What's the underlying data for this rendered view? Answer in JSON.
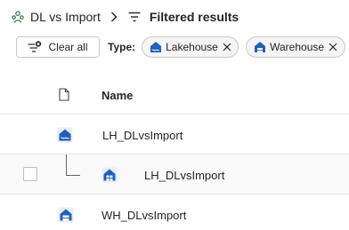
{
  "breadcrumb": {
    "workspace": "DL vs Import",
    "current": "Filtered results",
    "workspace_icon": "workspace-people-icon",
    "separator_icon": "chevron-right-icon",
    "filter_icon": "filter-lines-icon"
  },
  "filters": {
    "clear_label": "Clear all",
    "type_label": "Type:",
    "chips": [
      {
        "label": "Lakehouse",
        "icon": "lakehouse-icon"
      },
      {
        "label": "Warehouse",
        "icon": "warehouse-icon"
      }
    ]
  },
  "table": {
    "columns": {
      "name": "Name"
    },
    "rows": [
      {
        "name": "LH_DLvsImport",
        "type": "Lakehouse",
        "level": 0
      },
      {
        "name": "LH_DLvsImport",
        "type": "SQL analytics endpoint",
        "level": 1
      },
      {
        "name": "WH_DLvsImport",
        "type": "Warehouse",
        "level": 0
      }
    ]
  },
  "colors": {
    "accent": "#1f5fbf",
    "border": "#e6e6e6",
    "chip_bg": "#f5f5f5"
  }
}
